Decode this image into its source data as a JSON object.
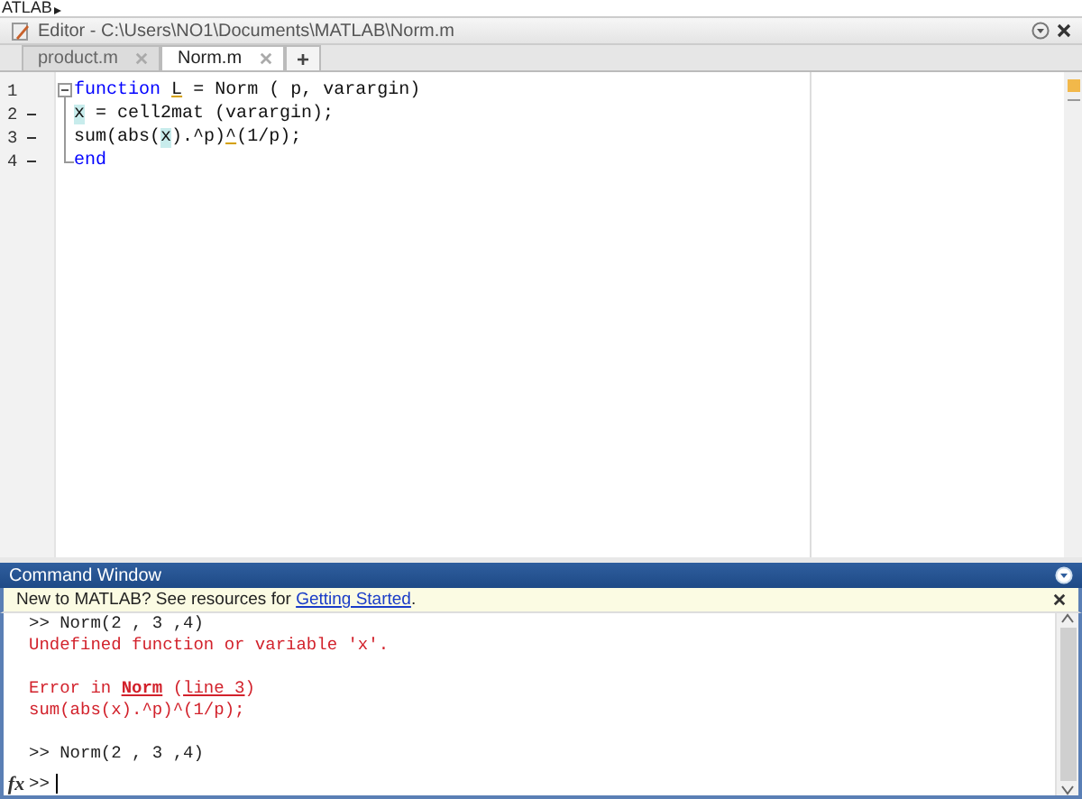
{
  "app_strip": {
    "label": "ATLAB"
  },
  "editor": {
    "title": "Editor - C:\\Users\\NO1\\Documents\\MATLAB\\Norm.m",
    "tabs": [
      {
        "label": "product.m",
        "selected": false
      },
      {
        "label": "Norm.m",
        "selected": true
      }
    ],
    "new_tab": "+",
    "lines": [
      {
        "number": "1",
        "executable": false,
        "fold_start": true,
        "fold_end": false,
        "tokens": [
          {
            "kind": "keyword",
            "text": "function"
          },
          {
            "kind": "underline",
            "text": " L"
          },
          {
            "kind": "plain",
            "text": " = Norm ( p, varargin)"
          }
        ]
      },
      {
        "number": "2",
        "executable": true,
        "fold_start": false,
        "fold_end": false,
        "tokens": [
          {
            "kind": "highlight",
            "text": "x"
          },
          {
            "kind": "plain",
            "text": " = cell2mat (varargin);"
          }
        ]
      },
      {
        "number": "3",
        "executable": true,
        "fold_start": false,
        "fold_end": false,
        "tokens": [
          {
            "kind": "plain",
            "text": "sum(abs("
          },
          {
            "kind": "highlight",
            "text": "x"
          },
          {
            "kind": "plain",
            "text": ").^p)"
          },
          {
            "kind": "underline",
            "text": "^"
          },
          {
            "kind": "plain",
            "text": "(1/p);"
          }
        ]
      },
      {
        "number": "4",
        "executable": true,
        "fold_start": false,
        "fold_end": true,
        "tokens": [
          {
            "kind": "keyword",
            "text": "end"
          }
        ]
      }
    ]
  },
  "command_window": {
    "title": "Command Window",
    "notice": {
      "text": "New to MATLAB? See resources for ",
      "link": "Getting Started",
      "end": "."
    },
    "lines": [
      {
        "kind": "echo",
        "segments": [
          {
            "kind": "text",
            "text": ">> Norm(2 , 3 ,4)"
          }
        ]
      },
      {
        "kind": "error",
        "segments": [
          {
            "kind": "text",
            "text": "Undefined function or variable 'x'."
          }
        ]
      },
      {
        "kind": "blank"
      },
      {
        "kind": "error",
        "segments": [
          {
            "kind": "text",
            "text": "Error in "
          },
          {
            "kind": "bold-link",
            "text": "Norm"
          },
          {
            "kind": "text",
            "text": " ("
          },
          {
            "kind": "link",
            "text": "line 3"
          },
          {
            "kind": "text",
            "text": ")"
          }
        ]
      },
      {
        "kind": "error",
        "segments": [
          {
            "kind": "text",
            "text": "sum(abs(x).^p)^(1/p);"
          }
        ]
      },
      {
        "kind": "blank"
      },
      {
        "kind": "echo",
        "segments": [
          {
            "kind": "text",
            "text": ">> Norm(2 , 3 ,4)"
          }
        ]
      }
    ],
    "prompt": {
      "fx": "fx",
      "text": ">>"
    }
  }
}
